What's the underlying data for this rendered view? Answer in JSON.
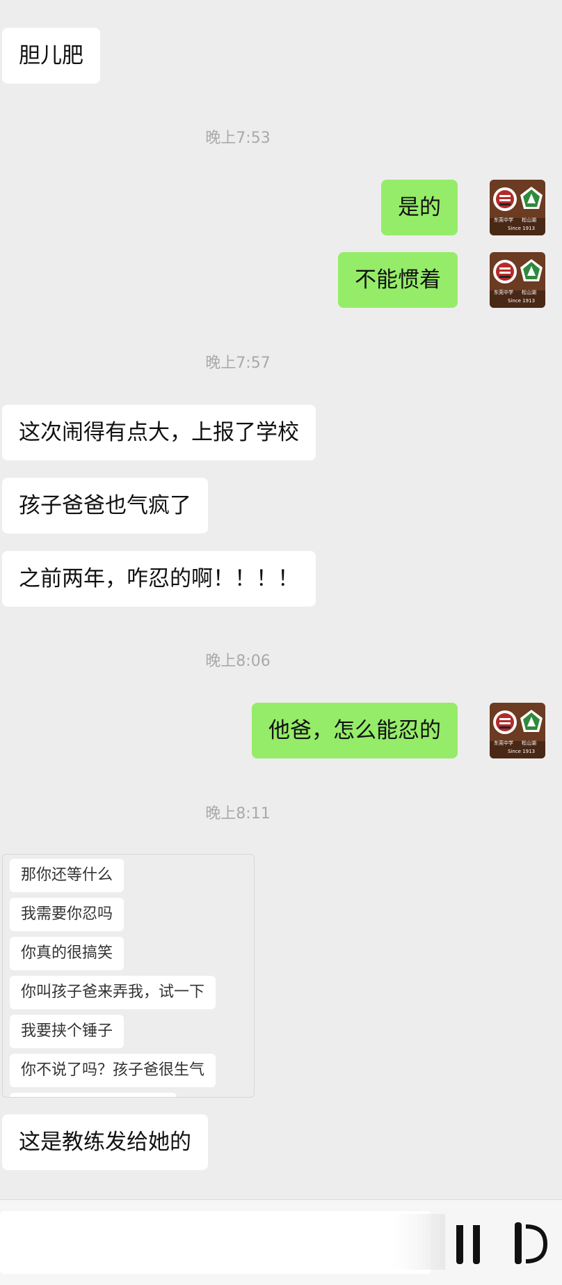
{
  "chat": {
    "timestamps": [
      "晚上7:53",
      "晚上7:57",
      "晚上8:06",
      "晚上8:11"
    ],
    "messages": {
      "m1": "胆儿肥",
      "m2": "是的",
      "m3": "不能惯着",
      "m4": "这次闹得有点大，上报了学校",
      "m5": "孩子爸爸也气疯了",
      "m6": "之前两年，咋忍的啊！！！！",
      "m7": "他爸，怎么能忍的",
      "m8": "这是教练发给她的"
    },
    "screenshot_messages": [
      "那你还等什么",
      "我需要你忍吗",
      "你真的很搞笑",
      "你叫孩子爸来弄我，试一下",
      "我要挟个锤子",
      "你不说了吗？孩子爸很生气"
    ],
    "avatar": {
      "left_caption": "东莞中学",
      "right_caption": "松山湖",
      "sub_caption": "Since 1913"
    }
  },
  "colors": {
    "background": "#ededed",
    "incoming_bubble": "#ffffff",
    "outgoing_bubble": "#95ec69",
    "timestamp": "#a9a9a9",
    "avatar_wood": "#6b3b22",
    "logo_green": "#2f8a3c",
    "logo_red": "#b32b2b"
  }
}
